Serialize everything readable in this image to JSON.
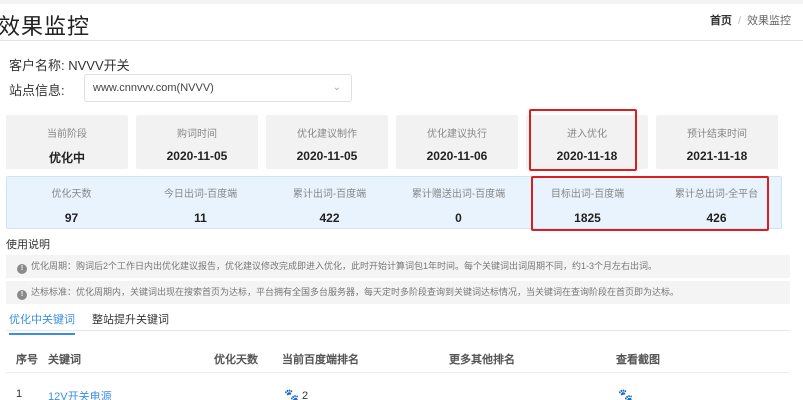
{
  "header": {
    "title": "效果监控",
    "breadcrumb": {
      "home": "首页",
      "separator": "/",
      "current": "效果监控"
    }
  },
  "customer": {
    "label": "客户名称:",
    "value": "NVVV开关"
  },
  "site": {
    "label": "站点信息:",
    "value": "www.cnnvvv.com(NVVV)"
  },
  "stages": [
    {
      "label": "当前阶段",
      "value": "优化中"
    },
    {
      "label": "购词时间",
      "value": "2020-11-05"
    },
    {
      "label": "优化建议制作",
      "value": "2020-11-05"
    },
    {
      "label": "优化建议执行",
      "value": "2020-11-06"
    },
    {
      "label": "进入优化",
      "value": "2020-11-18"
    },
    {
      "label": "预计结束时间",
      "value": "2021-11-18"
    }
  ],
  "metrics": [
    {
      "label": "优化天数",
      "value": "97"
    },
    {
      "label": "今日出词-百度端",
      "value": "11"
    },
    {
      "label": "累计出词-百度端",
      "value": "422"
    },
    {
      "label": "累计赠送出词-百度端",
      "value": "0"
    },
    {
      "label": "目标出词-百度端",
      "value": "1825"
    },
    {
      "label": "累计总出词-全平台",
      "value": "426"
    }
  ],
  "usage": {
    "title": "使用说明",
    "notes": [
      "优化周期：购词后2个工作日内出优化建议报告，优化建议修改完成即进入优化，此时开始计算词包1年时间。每个关键词出词周期不同，约1-3个月左右出词。",
      "达标标准：优化周期内，关键词出现在搜索首页为达标，平台拥有全国多台服务器，每天定时多阶段查询到关键词达标情况，当关键词在查询阶段在首页即为达标。"
    ]
  },
  "tabs": [
    {
      "label": "优化中关键词",
      "active": true
    },
    {
      "label": "整站提升关键词",
      "active": false
    }
  ],
  "table": {
    "columns": [
      "序号",
      "关键词",
      "优化天数",
      "当前百度端排名",
      "更多其他排名",
      "查看截图"
    ],
    "rows": [
      {
        "index": "1",
        "keyword": "12V开关电源",
        "rank": "2"
      }
    ]
  },
  "colors": {
    "accent": "#3a8ee6",
    "highlight": "#d81e1e",
    "metrics_bg": "#e9f3fd"
  }
}
